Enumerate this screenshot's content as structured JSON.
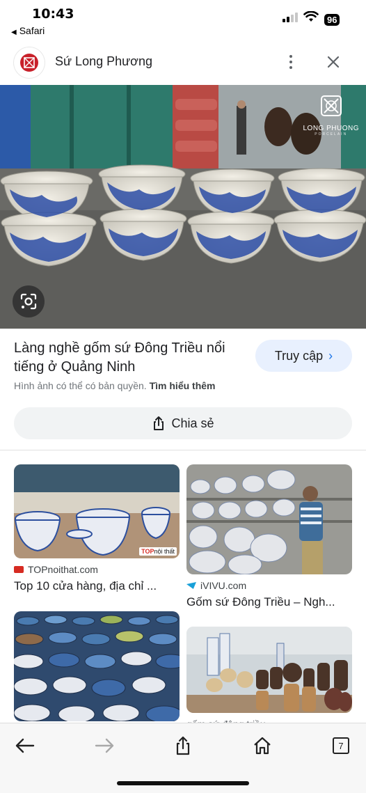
{
  "status_bar": {
    "time": "10:43",
    "back_app": "Safari",
    "battery": "96"
  },
  "header": {
    "site_title": "Sứ Long Phương",
    "logo_color": "#c8202a"
  },
  "hero": {
    "brand_name": "LONG PHUONG",
    "brand_sub": "PORCELAIN"
  },
  "result": {
    "title": "Làng nghề gốm sứ Đông Triều nổi tiếng ở Quảng Ninh",
    "visit_label": "Truy cập",
    "copyright_text": "Hình ảnh có thể có bản quyền.",
    "learn_more": "Tìm hiểu thêm",
    "share_label": "Chia sẻ"
  },
  "related": [
    {
      "source": "TOPnoithat.com",
      "caption": "Top 10 cửa hàng, địa chỉ ...",
      "badge_top": "TOP",
      "badge_rest": "nội thất"
    },
    {
      "source": "iVIVU.com",
      "caption": "Gốm sứ Đông Triều – Ngh..."
    },
    {
      "source": "",
      "caption": ""
    },
    {
      "source": "gốm sứ đông triều",
      "caption": ""
    }
  ],
  "toolbar": {
    "tab_count": "7"
  },
  "colors": {
    "accent": "#1a73e8",
    "button_bg": "#e8f0fe",
    "share_bg": "#f1f3f4"
  }
}
